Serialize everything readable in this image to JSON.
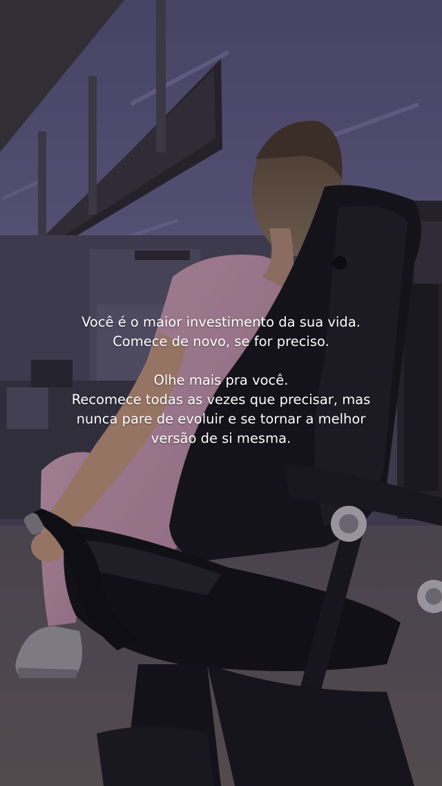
{
  "caption": {
    "paragraph_1": [
      "Você é o maior investimento da sua vida.",
      "Comece de novo, se for preciso."
    ],
    "paragraph_2": [
      "Olhe mais pra você.",
      "Recomece todas as vezes que precisar, mas",
      "nunca pare de evoluir e se tornar a melhor",
      "versão de si mesma."
    ]
  }
}
